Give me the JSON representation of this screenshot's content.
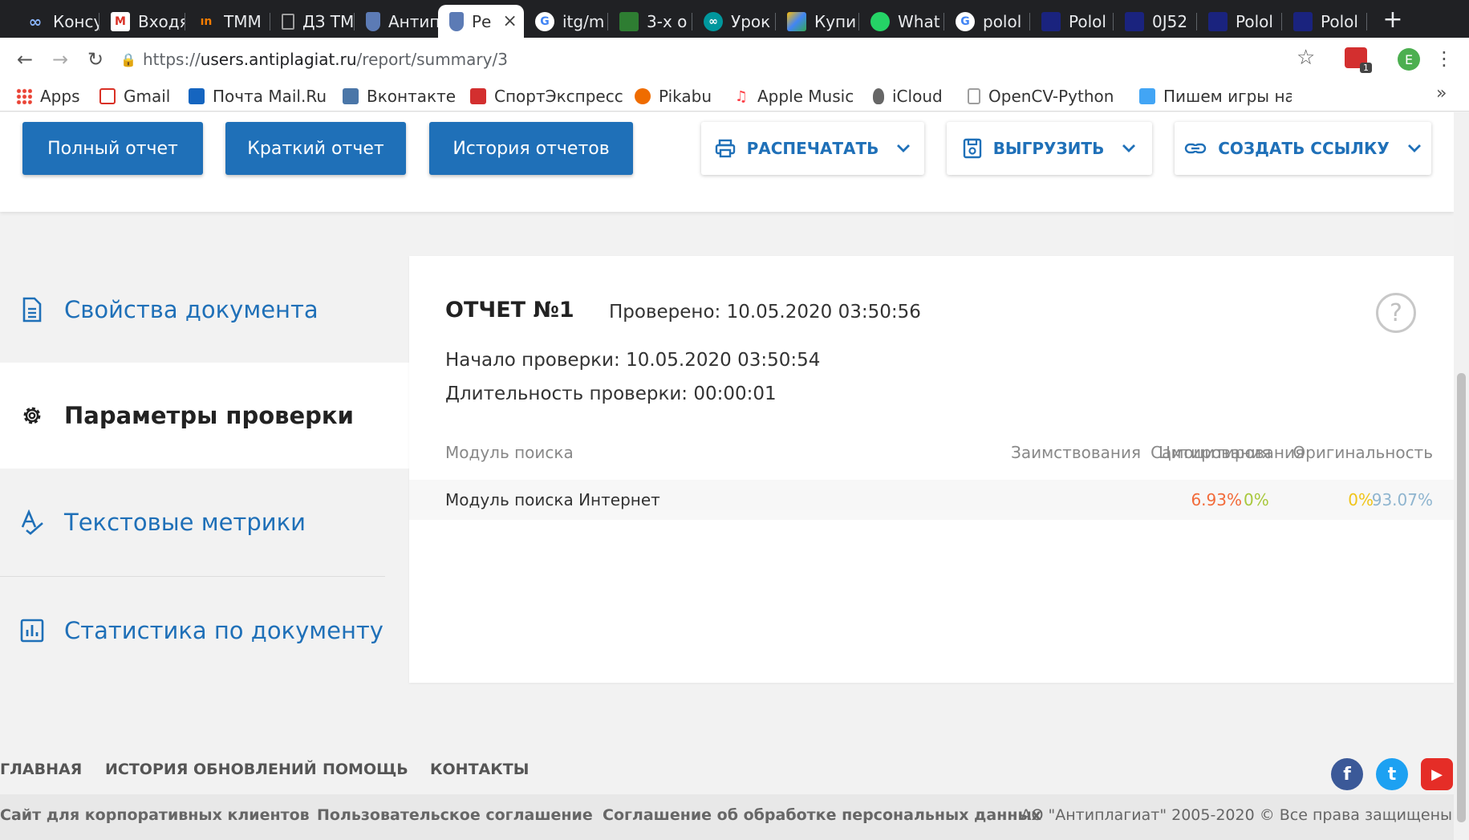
{
  "browser": {
    "tabs": [
      {
        "label": "Консу",
        "color": "#1a73e8",
        "glyph": "∞",
        "active": false
      },
      {
        "label": "Входя",
        "color": "#d93025",
        "glyph": "M",
        "active": false
      },
      {
        "label": "TMM",
        "color": "#f57c00",
        "glyph": "ın",
        "active": false
      },
      {
        "label": "ДЗ ТМ",
        "color": "#9e9e9e",
        "glyph": "",
        "active": false
      },
      {
        "label": "Антип",
        "color": "#3b5998",
        "glyph": "",
        "active": false
      },
      {
        "label": "Ре",
        "color": "#3b5998",
        "glyph": "",
        "active": true,
        "close": "×"
      },
      {
        "label": "itg/m",
        "color": "#4285f4",
        "glyph": "G",
        "active": false
      },
      {
        "label": "3-х о",
        "color": "#2e7d32",
        "glyph": "",
        "active": false
      },
      {
        "label": "Урок",
        "color": "#00979d",
        "glyph": "∞",
        "active": false
      },
      {
        "label": "Купи",
        "color": "#fbbc05",
        "glyph": "",
        "active": false
      },
      {
        "label": "What",
        "color": "#25d366",
        "glyph": "",
        "active": false
      },
      {
        "label": "polol",
        "color": "#4285f4",
        "glyph": "G",
        "active": false
      },
      {
        "label": "Polol",
        "color": "#1a237e",
        "glyph": "",
        "active": false
      },
      {
        "label": "0J52",
        "color": "#1a237e",
        "glyph": "",
        "active": false
      },
      {
        "label": "Polol",
        "color": "#1a237e",
        "glyph": "",
        "active": false
      },
      {
        "label": "Polol",
        "color": "#1a237e",
        "glyph": "",
        "active": false
      }
    ],
    "url_prefix": "https://",
    "url_host": "users.antiplagiat.ru",
    "url_path": "/report/summary/3",
    "extension_badge": "1",
    "profile_initial": "E",
    "bookmarks": [
      {
        "label": "Apps",
        "color": "#e53935"
      },
      {
        "label": "Gmail",
        "color": "#d93025"
      },
      {
        "label": "Почта Mail.Ru",
        "color": "#1565c0"
      },
      {
        "label": "Вконтакте",
        "color": "#4a76a8"
      },
      {
        "label": "СпортЭкспресс",
        "color": "#d32f2f"
      },
      {
        "label": "Pikabu",
        "color": "#ef6c00"
      },
      {
        "label": "Apple Music",
        "color": "#fc3c44"
      },
      {
        "label": "iCloud",
        "color": "#555555"
      },
      {
        "label": "OpenCV-Python",
        "color": "#9e9e9e"
      },
      {
        "label": "Пишем игры на",
        "color": "#42a5f5"
      }
    ],
    "bookmarks_more": "»"
  },
  "toolbar": {
    "full_report": "Полный отчет",
    "short_report": "Краткий отчет",
    "history": "История отчетов",
    "print": "РАСПЕЧАТАТЬ",
    "export": "ВЫГРУЗИТЬ",
    "create_link": "СОЗДАТЬ ССЫЛКУ"
  },
  "sidebar": {
    "items": [
      {
        "label": "Свойства документа",
        "icon": "document-icon",
        "active": false
      },
      {
        "label": "Параметры проверки",
        "icon": "gear-icon",
        "active": true
      },
      {
        "label": "Текстовые метрики",
        "icon": "text-metrics-icon",
        "active": false
      },
      {
        "label": "Статистика по документу",
        "icon": "chart-icon",
        "active": false
      }
    ]
  },
  "report": {
    "title": "ОТЧЕТ №1",
    "checked": "Проверено: 10.05.2020 03:50:56",
    "start": "Начало проверки: 10.05.2020 03:50:54",
    "duration": "Длительность проверки: 00:00:01",
    "help": "?",
    "table": {
      "headers": [
        "Модуль поиска",
        "Заимствования",
        "Самоцитирования",
        "Цитирования",
        "Оригинальность"
      ],
      "rows": [
        {
          "module": "Модуль поиска Интернет",
          "borrowings": "6.93%",
          "self_citations": "0%",
          "citations": "0%",
          "originality": "93.07%"
        }
      ]
    },
    "colors": {
      "borrowings": "#f26b3a",
      "self_citations": "#f0c419",
      "citations": "#a8c83c",
      "originality": "#8fb5cf"
    }
  },
  "footer": {
    "nav": [
      "ГЛАВНАЯ",
      "ИСТОРИЯ ОБНОВЛЕНИЙ",
      "ПОМОЩЬ",
      "КОНТАКТЫ"
    ],
    "links": [
      "Сайт для корпоративных клиентов",
      "Пользовательское соглашение",
      "Соглашение об обработке персональных данных"
    ],
    "copyright": "АО \"Антиплагиат\" 2005-2020 © Все права защищены",
    "social": [
      {
        "name": "facebook",
        "glyph": "f",
        "color": "#3b5998"
      },
      {
        "name": "twitter",
        "glyph": "t",
        "color": "#1da1f2"
      },
      {
        "name": "youtube",
        "glyph": "▶",
        "color": "#e52d27"
      }
    ]
  },
  "colors": {
    "accent": "#1f70b8",
    "chrome_dark": "#202124"
  }
}
